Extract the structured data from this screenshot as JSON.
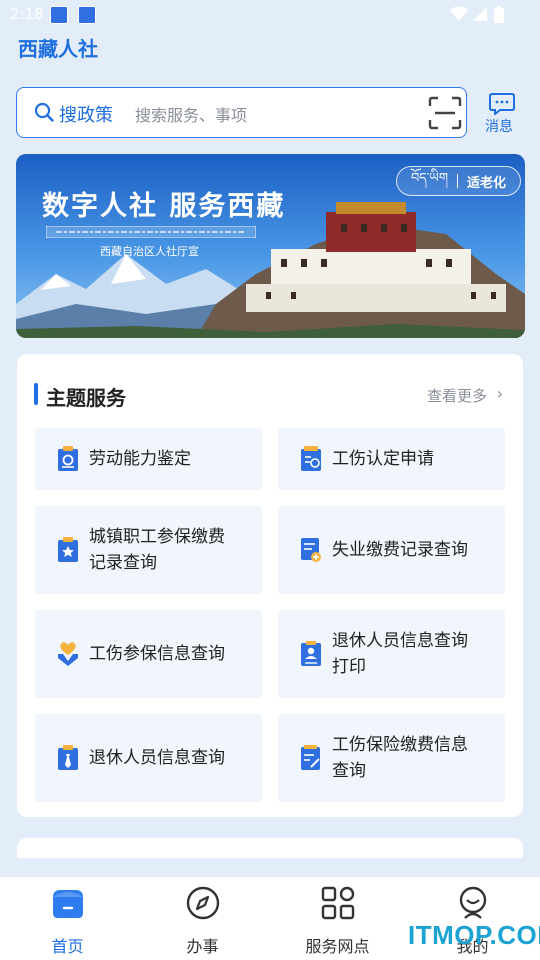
{
  "status": {
    "time": "2:18"
  },
  "app": {
    "title": "西藏人社"
  },
  "search": {
    "label": "搜政策",
    "placeholder": "搜索服务、事项"
  },
  "messages": {
    "label": "消息"
  },
  "banner": {
    "headline": "数字人社 服务西藏",
    "org": "西藏自治区人社厅宣",
    "elder_mode_tibetan": "བོད་ཡིག",
    "elder_mode_label": "适老化"
  },
  "theme_services": {
    "title": "主题服务",
    "more": "查看更多",
    "items": [
      {
        "line1": "劳动能力鉴定",
        "line2": "",
        "icon": "document-seal-icon"
      },
      {
        "line1": "工伤认定申请",
        "line2": "",
        "icon": "form-tag-icon"
      },
      {
        "line1": "城镇职工参保缴费",
        "line2": "记录查询",
        "icon": "star-file-icon"
      },
      {
        "line1": "失业缴费记录查询",
        "line2": "",
        "icon": "record-plus-icon"
      },
      {
        "line1": "工伤参保信息查询",
        "line2": "",
        "icon": "heart-hand-icon"
      },
      {
        "line1": "退休人员信息查询",
        "line2": "打印",
        "icon": "person-card-icon"
      },
      {
        "line1": "退休人员信息查询",
        "line2": "",
        "icon": "tie-badge-icon"
      },
      {
        "line1": "工伤保险缴费信息",
        "line2": "查询",
        "icon": "form-pen-icon"
      }
    ]
  },
  "nav": {
    "items": [
      {
        "label": "首页",
        "active": true
      },
      {
        "label": "办事",
        "active": false
      },
      {
        "label": "服务网点",
        "active": false
      },
      {
        "label": "我的",
        "active": false
      }
    ]
  },
  "watermark": "ITMOP.COM",
  "colors": {
    "accent": "#1f6fe0",
    "background": "#e3edf9",
    "tile": "#f1f5fc"
  }
}
